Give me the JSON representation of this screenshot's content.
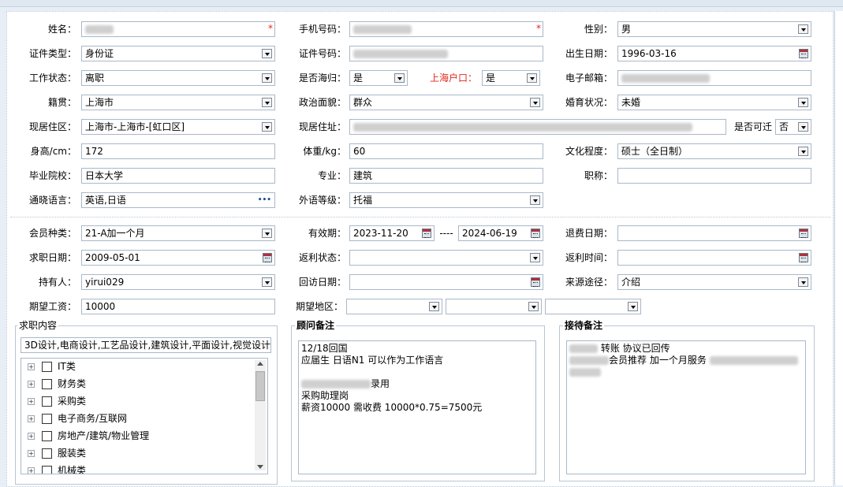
{
  "form": {
    "name_label": "姓名：",
    "phone_label": "手机号码：",
    "gender_label": "性别：",
    "gender_value": "男",
    "id_type_label": "证件类型：",
    "id_type_value": "身份证",
    "id_no_label": "证件号码：",
    "birth_label": "出生日期：",
    "birth_value": "1996-03-16",
    "work_status_label": "工作状态：",
    "work_status_value": "离职",
    "returnee_label": "是否海归：",
    "returnee_value": "是",
    "shanghai_hukou_label": "上海户口：",
    "shanghai_hukou_value": "是",
    "email_label": "电子邮箱：",
    "native_label": "籍贯：",
    "native_value": "上海市",
    "political_label": "政治面貌：",
    "political_value": "群众",
    "marital_label": "婚育状况：",
    "marital_value": "未婚",
    "current_area_label": "现居住区：",
    "current_area_value": "上海市-上海市-[虹口区]",
    "current_addr_label": "现居住址：",
    "relocate_label": "是否可迁",
    "relocate_value": "否",
    "height_label": "身高/cm：",
    "height_value": "172",
    "weight_label": "体重/kg：",
    "weight_value": "60",
    "education_label": "文化程度：",
    "education_value": "硕士（全日制）",
    "school_label": "毕业院校：",
    "school_value": "日本大学",
    "major_label": "专业：",
    "major_value": "建筑",
    "title_label": "职称：",
    "title_value": "",
    "language_label": "通晓语言：",
    "language_value": "英语,日语",
    "language_more": "•••",
    "lang_level_label": "外语等级：",
    "lang_level_value": "托福"
  },
  "membership": {
    "member_type_label": "会员种类：",
    "member_type_value": "21-A加一个月",
    "valid_label": "有效期：",
    "valid_from": "2023-11-20",
    "valid_sep": "----",
    "valid_to": "2024-06-19",
    "refund_date_label": "退费日期：",
    "refund_date_value": "",
    "job_date_label": "求职日期：",
    "job_date_value": "2009-05-01",
    "rebate_status_label": "返利状态：",
    "rebate_status_value": "",
    "rebate_time_label": "返利时间：",
    "rebate_time_value": "",
    "holder_label": "持有人：",
    "holder_value": "yirui029",
    "visit_date_label": "回访日期：",
    "visit_date_value": "",
    "source_label": "来源途径：",
    "source_value": "介绍",
    "salary_label": "期望工资：",
    "salary_value": "10000",
    "area_label": "期望地区："
  },
  "job_content": {
    "title": "求职内容",
    "selected": "3D设计,电商设计,工艺品设计,建筑设计,平面设计,视觉设计",
    "tree": [
      "IT类",
      "财务类",
      "采购类",
      "电子商务/互联网",
      "房地产/建筑/物业管理",
      "服装类",
      "机械类"
    ]
  },
  "advisor_note": {
    "title": "顾问备注",
    "lines": [
      "12/18回国",
      "应届生 日语N1 可以作为工作语言",
      "",
      "录用",
      "采购助理岗",
      "薪资10000 需收费 10000*0.75=7500元"
    ]
  },
  "reception_note": {
    "title": "接待备注",
    "line1": "转账 协议已回传",
    "line2": "会员推荐 加一个月服务"
  },
  "colors": {
    "required_star": "#e0281c",
    "hukou_label": "#e0281c",
    "border": "#a9b8c8"
  },
  "icons": {
    "required": "*",
    "dropdown": "dropdown-arrow-icon",
    "calendar": "calendar-icon",
    "expand": "+"
  }
}
